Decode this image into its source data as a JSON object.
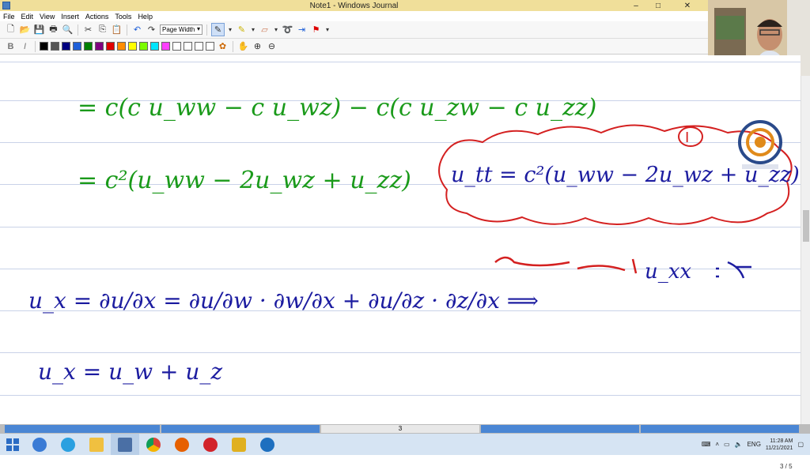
{
  "window": {
    "title": "Note1 - Windows Journal",
    "minimize": "–",
    "maximize": "□",
    "close": "✕"
  },
  "menu": [
    "File",
    "Edit",
    "View",
    "Insert",
    "Actions",
    "Tools",
    "Help"
  ],
  "toolbar": {
    "zoom_value": "Page Width",
    "colors": [
      "#000000",
      "#555555",
      "#000080",
      "#1e5fd8",
      "#008000",
      "#800080",
      "#e00000",
      "#ff8c00",
      "#ffff00",
      "#7cfc00",
      "#00e5ff",
      "#ff40ff",
      "#ffffff",
      "#ffffff",
      "#ffffff",
      "#ffffff"
    ]
  },
  "document": {
    "page_indicator": "3 / 5",
    "current_page": "3"
  },
  "ink": {
    "line1": "= c(c u_ww − c u_wz) − c(c u_zw − c u_zz)",
    "line2": "= c²(u_ww − 2u_wz + u_zz)",
    "boxed_result": "u_tt = c²(u_ww − 2u_wz + u_zz)",
    "boxed_label": "I",
    "note": "u_xx",
    "line3": "u_x = ∂u/∂x = ∂u/∂w · ∂w/∂x + ∂u/∂z · ∂z/∂x ⟹",
    "line4": "u_x = u_w + u_z"
  },
  "taskbar": {
    "language": "ENG",
    "time": "11:28 AM",
    "date": "11/21/2021"
  }
}
